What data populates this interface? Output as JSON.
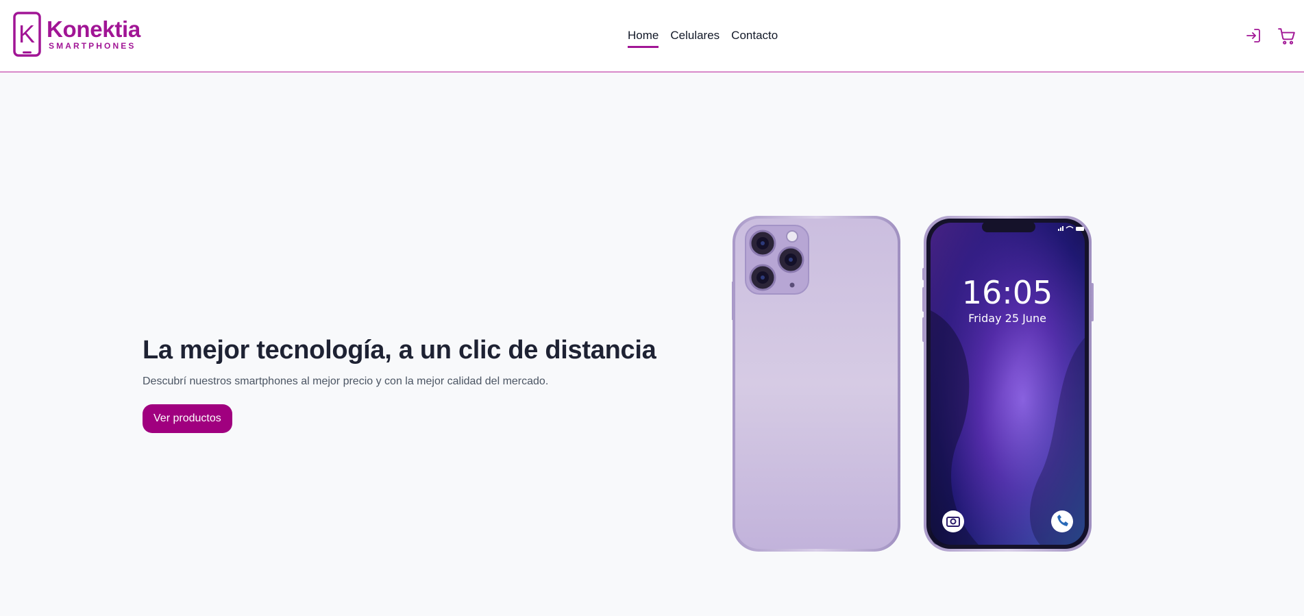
{
  "brand": {
    "name": "Konektia",
    "tagline": "SMARTPHONES",
    "mark_letter": "K",
    "color": "#a11595"
  },
  "nav": {
    "items": [
      {
        "label": "Home",
        "active": true
      },
      {
        "label": "Celulares",
        "active": false
      },
      {
        "label": "Contacto",
        "active": false
      }
    ]
  },
  "header_icons": [
    "login-icon",
    "cart-icon"
  ],
  "hero": {
    "title": "La mejor tecnología, a un clic de distancia",
    "subtitle": "Descubrí nuestros smartphones al mejor precio y con la mejor calidad del mercado.",
    "cta_label": "Ver productos"
  },
  "phone_screen": {
    "time": "16:05",
    "date": "Friday 25 June"
  },
  "colors": {
    "accent": "#a0007f",
    "page_bg": "#f8f9fb",
    "header_border": "#d889c9"
  }
}
